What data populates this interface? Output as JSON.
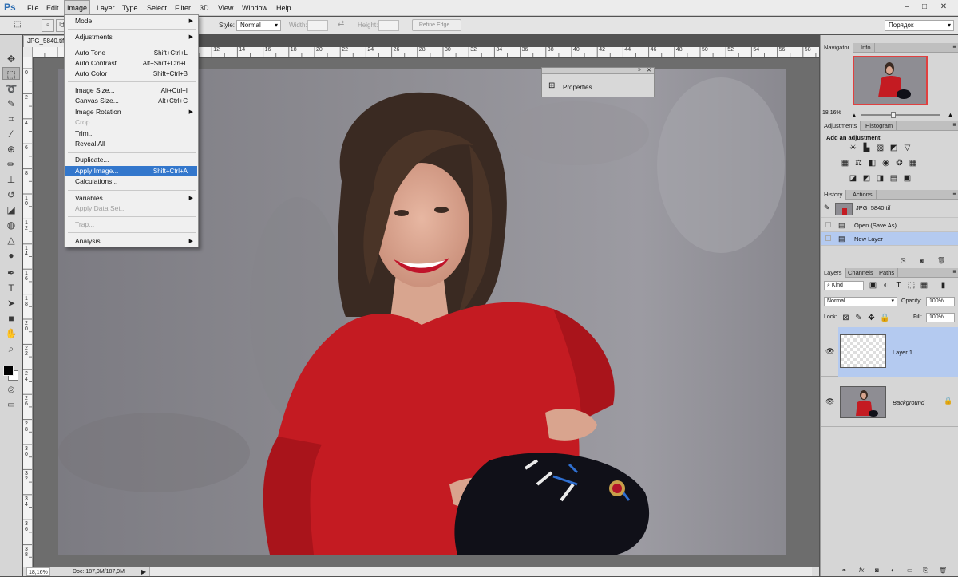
{
  "app": {
    "logo": "Ps"
  },
  "menubar": {
    "items": [
      "File",
      "Edit",
      "Image",
      "Layer",
      "Type",
      "Select",
      "Filter",
      "3D",
      "View",
      "Window",
      "Help"
    ],
    "active": "Image",
    "window_controls": [
      "‒",
      "□",
      "✕"
    ]
  },
  "options": {
    "style_label": "Style:",
    "style_value": "Normal",
    "width_label": "Width:",
    "height_label": "Height:",
    "refine_edge": "Refine Edge...",
    "workspace": "Порядок"
  },
  "document": {
    "tab_title": "JPG_5840.tif",
    "zoom": "18,16%",
    "doc_info": "Doc: 187,9M/187,9M",
    "ruler_top": [
      "2",
      "4",
      "6",
      "8",
      "10",
      "12",
      "14",
      "16",
      "18",
      "20",
      "22",
      "24",
      "26",
      "28",
      "30",
      "32",
      "34",
      "36",
      "38",
      "40",
      "42",
      "44",
      "46",
      "48",
      "50",
      "52",
      "54",
      "56",
      "58",
      "60"
    ],
    "ruler_left": [
      "0",
      "2",
      "4",
      "6",
      "8",
      "1\n0",
      "1\n2",
      "1\n4",
      "1\n6",
      "1\n8",
      "2\n0",
      "2\n2",
      "2\n4",
      "2\n6",
      "2\n8",
      "3\n0",
      "3\n2",
      "3\n4",
      "3\n6",
      "3\n8"
    ]
  },
  "image_menu": {
    "mode": "Mode",
    "adjustments": "Adjustments",
    "auto_tone": "Auto Tone",
    "auto_tone_sc": "Shift+Ctrl+L",
    "auto_contrast": "Auto Contrast",
    "auto_contrast_sc": "Alt+Shift+Ctrl+L",
    "auto_color": "Auto Color",
    "auto_color_sc": "Shift+Ctrl+B",
    "image_size": "Image Size...",
    "image_size_sc": "Alt+Ctrl+I",
    "canvas_size": "Canvas Size...",
    "canvas_size_sc": "Alt+Ctrl+C",
    "image_rotation": "Image Rotation",
    "crop": "Crop",
    "trim": "Trim...",
    "reveal_all": "Reveal All",
    "duplicate": "Duplicate...",
    "apply_image": "Apply Image...",
    "apply_image_sc": "Shift+Ctrl+A",
    "calculations": "Calculations...",
    "variables": "Variables",
    "apply_data_set": "Apply Data Set...",
    "trap": "Trap...",
    "analysis": "Analysis"
  },
  "properties_panel": {
    "title": "Properties"
  },
  "navigator": {
    "tabs": [
      "Navigator",
      "Info"
    ],
    "zoom": "18,16%"
  },
  "adjustments": {
    "tabs": [
      "Adjustments",
      "Histogram"
    ],
    "heading": "Add an adjustment"
  },
  "history": {
    "tabs": [
      "History",
      "Actions"
    ],
    "snapshot": "JPG_5840.tif",
    "steps": [
      "Open (Save As)",
      "New Layer"
    ]
  },
  "layers": {
    "tabs": [
      "Layers",
      "Channels",
      "Paths"
    ],
    "kind": "Kind",
    "blend_mode": "Normal",
    "opacity_label": "Opacity:",
    "opacity": "100%",
    "lock_label": "Lock:",
    "fill_label": "Fill:",
    "fill": "100%",
    "items": [
      {
        "name": "Layer 1"
      },
      {
        "name": "Background"
      }
    ]
  },
  "colors": {
    "selection": "#3377cc",
    "layer_selected": "#b4caf0",
    "red_dress": "#c41b22"
  }
}
